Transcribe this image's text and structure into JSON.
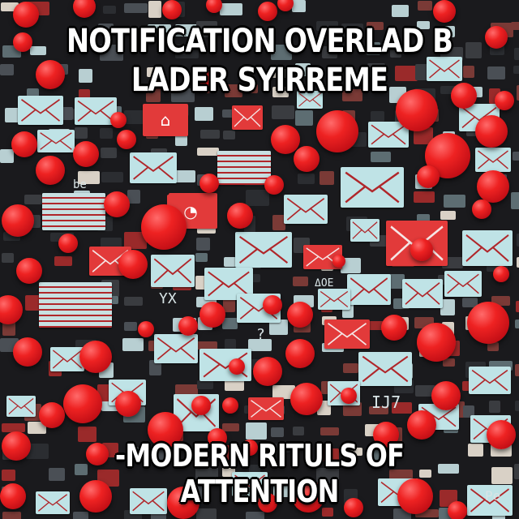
{
  "title_lines": [
    "NOTIFICATION OVERLAD B",
    "LADER SYIRREME"
  ],
  "caption": "-MODERN RITULS OF ATTENTION",
  "scattered_marks": [
    "ΔOE",
    "IJ7",
    "be",
    "Pe",
    "?",
    "YX"
  ],
  "colors": {
    "background": "#1a1a1d",
    "envelope_pale": "#bfe3e6",
    "envelope_red": "#e23a3a",
    "bubble_red": "#ee2222",
    "text": "#ffffff"
  },
  "icons": [
    "envelope-icon",
    "notification-bubble-icon",
    "home-icon",
    "bell-icon"
  ]
}
